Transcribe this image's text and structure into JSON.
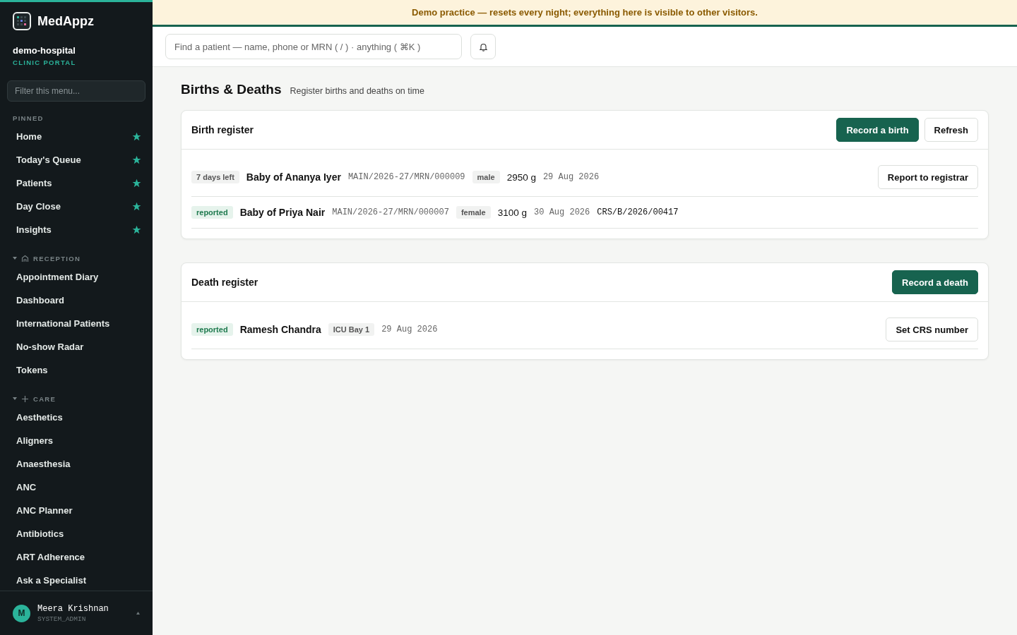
{
  "sidebar": {
    "brand": "MedAppz",
    "org": "demo-hospital",
    "portal": "CLINIC PORTAL",
    "filter": {
      "placeholder": "Filter this menu..."
    },
    "sections": [
      {
        "kind": "pinned",
        "title": "PINNED",
        "items": [
          {
            "label": "Home",
            "pinned": true
          },
          {
            "label": "Today's Queue",
            "pinned": true
          },
          {
            "label": "Patients",
            "pinned": true
          },
          {
            "label": "Day Close",
            "pinned": true
          },
          {
            "label": "Insights",
            "pinned": true
          }
        ]
      },
      {
        "kind": "group",
        "title": "RECEPTION",
        "expanded": true,
        "items": [
          {
            "label": "Appointment Diary",
            "pinned": false
          },
          {
            "label": "Dashboard",
            "pinned": false
          },
          {
            "label": "International Patients",
            "pinned": false
          },
          {
            "label": "No-show Radar",
            "pinned": false
          },
          {
            "label": "Tokens",
            "pinned": false
          }
        ]
      },
      {
        "kind": "group",
        "title": "CARE",
        "expanded": true,
        "items": [
          {
            "label": "Aesthetics",
            "pinned": false
          },
          {
            "label": "Aligners",
            "pinned": false
          },
          {
            "label": "Anaesthesia",
            "pinned": false
          },
          {
            "label": "ANC",
            "pinned": false
          },
          {
            "label": "ANC Planner",
            "pinned": false
          },
          {
            "label": "Antibiotics",
            "pinned": false
          },
          {
            "label": "ART Adherence",
            "pinned": false
          },
          {
            "label": "Ask a Specialist",
            "pinned": false
          }
        ]
      }
    ],
    "user": {
      "initial": "M",
      "name": "Meera Krishnan",
      "role": "SYSTEM_ADMIN"
    }
  },
  "banner": "Demo practice — resets every night; everything here is visible to other visitors.",
  "search": {
    "placeholder": "Find a patient — name, phone or MRN ( / ) · anything ( ⌘K )"
  },
  "page": {
    "title": "Births & Deaths",
    "subtitle": "Register births and deaths on time"
  },
  "registers": [
    {
      "title": "Birth register",
      "buttons": [
        {
          "label": "Record a birth",
          "kind": "primary"
        },
        {
          "label": "Refresh",
          "kind": "secondary"
        }
      ],
      "rows": [
        {
          "status": {
            "text": "7 days left",
            "kind": "pending"
          },
          "name": "Baby of Ananya Iyer",
          "mrn": "MAIN/2026-27/MRN/000009",
          "tag": "male",
          "weight": "2950 g",
          "date": "29 Aug 2026",
          "action": "Report to registrar"
        },
        {
          "status": {
            "text": "reported",
            "kind": "done"
          },
          "name": "Baby of Priya Nair",
          "mrn": "MAIN/2026-27/MRN/000007",
          "tag": "female",
          "weight": "3100 g",
          "date": "30 Aug 2026",
          "crs": "CRS/B/2026/00417"
        }
      ]
    },
    {
      "title": "Death register",
      "buttons": [
        {
          "label": "Record a death",
          "kind": "primary"
        }
      ],
      "rows": [
        {
          "status": {
            "text": "reported",
            "kind": "done"
          },
          "name": "Ramesh Chandra",
          "tag": "ICU Bay 1",
          "date": "29 Aug 2026",
          "action": "Set CRS number"
        }
      ]
    }
  ]
}
